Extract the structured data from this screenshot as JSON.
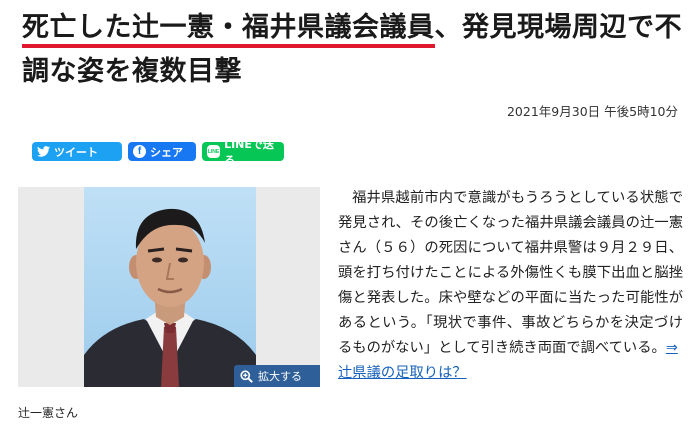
{
  "article": {
    "headline_highlight": "死亡した辻一憲・福井県議会議員",
    "headline_rest": "、発見現場周辺で不調な姿を複数目撃",
    "date": "2021年9月30日 午後5時10分",
    "share": {
      "tweet": "ツイート",
      "facebook": "シェア",
      "line": "LINEで送る",
      "line_icon_text": "LINE"
    },
    "photo": {
      "zoom_label": "拡大する",
      "caption": "辻一憲さん"
    },
    "body": "福井県越前市内で意識がもうろうとしている状態で発見され、その後亡くなった福井県議会議員の辻一憲さん（５６）の死因について福井県警は９月２９日、頭を打ち付けたことによる外傷性くも膜下出血と脳挫傷と発表した。床や壁などの平面に当たった可能性があるという。「現状で事件、事故どちらかを決定づけるものがない」として引き続き両面で調べている。",
    "related_link_arrow": "⇒",
    "related_link": "辻県議の足取りは？"
  },
  "colors": {
    "underline": "#e0182d",
    "twitter": "#1da1f2",
    "facebook": "#1877f2",
    "line": "#06c755",
    "link": "#1560bd",
    "zoom_button": "#2f5f99"
  }
}
